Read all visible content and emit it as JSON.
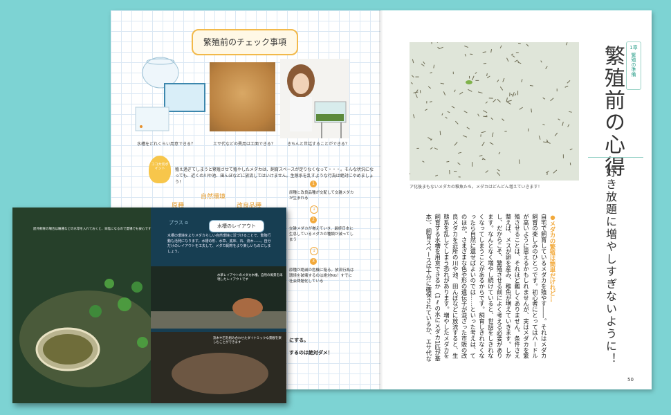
{
  "left_page": {
    "check_title": "繁殖前のチェック事項",
    "captions": [
      "水槽をどれくらい用意できる？",
      "エサ代などの費用は工面できる？",
      "きちんと世話することができる？"
    ],
    "bulb_label": "ココ大切ポイント",
    "tip_text": "殖え過ぎてしまうと繁殖させて殖やしたメダカは、飼育スペースが足りなくなって・・・。そんな状況になっても、近くの川や池、田んぼなどに放流してはいけません。生態系を乱すような行為は絶対にやめましょう！",
    "env": {
      "title": "自然環境",
      "left_label": "原種",
      "right_label": "改良品種"
    },
    "steps": [
      {
        "num": "1",
        "text": "原種と改良品種が交配して交雑メダカが生まれる"
      },
      {
        "num": "2",
        "text": "交雑メダカが増えていき、最終日本に生息しているメダカの種類が減ってしまう"
      },
      {
        "num": "3",
        "text": "原種が絶滅の危機に陥る。放流行為は環境を破壊するのは絶対NG！すでに社会問題化している"
      }
    ],
    "arrow_glyph": "↓",
    "bottom_lines": [
      "にする。",
      "するのは絶対ダメ！"
    ]
  },
  "right_page": {
    "photo_caption": "ア化後まもないメダカの稚魚たち。メダカはどんどん増えていきます！",
    "chapter_number": "1章",
    "chapter_label": "繁殖の準備",
    "heading": "繁殖前の心得",
    "subheading": "好き放題に増やしすぎないように！",
    "section_title": "●メダカの繁殖は簡単だけれど…",
    "body": "自宅で飼育しているメダカを殖やす――。それはメダカ飼育の楽しみのひとつです。初心者にとってはハードルが高いように思えるかもしれませんが、実はメダカを繁殖させることは、それほど難しくありません。条件さえ整えば、メスが卵を産み、稚魚が増えていきます。しかし、だからこそ、繁殖させる前によく考える必要があります。なんとなく増やし続けていると、世話をしきれなくなってしまうことがあるからです。飼育しきれなくなったら自然に還せばよいのでは……といった考えは、てのほか。さまざまな色や形の遺伝子が混ざった市販の改良メダカを近所の川や池、田んぼなどに放流すると、生態系を乱してしまう恐れがあります。増やしたメダカを飼育する水槽を用意できるか（1ℓの水にメダカ1匹が基本）、飼育スペースは十分に確保されているか、エサ代などの費用、世話の負担増は問題ないかといったことを考えたうえで、繁殖させましょう。",
    "page_number": "50"
  },
  "inset": {
    "photo_caption": "屋外飼育の場合は睡蓮などの水草を入れておくと、日陰になるので夏場でも安心です",
    "plus_tag": "プラス α",
    "layout_title": "水槽のレイアウト",
    "layout_desc": "水槽の環境をよりメダカらしい自然環境に近づけることで、繁殖行動も活発になります。水槽の形、水草、底床、石、流木……。自分だけのレイアウトを工夫して、メダカ飼育をより楽しいものにしましょう。",
    "caption_mid": "水草レイアウトのメダカ水槽。自然の風景を再現したレイアウトです",
    "caption_bottom": "流木や石を組み合わせたダイナミックな景観を楽しむことができます"
  },
  "colors": {
    "background": "#7dd3d3",
    "accent_orange": "#f2a93b",
    "accent_teal": "#2a9e8a"
  }
}
